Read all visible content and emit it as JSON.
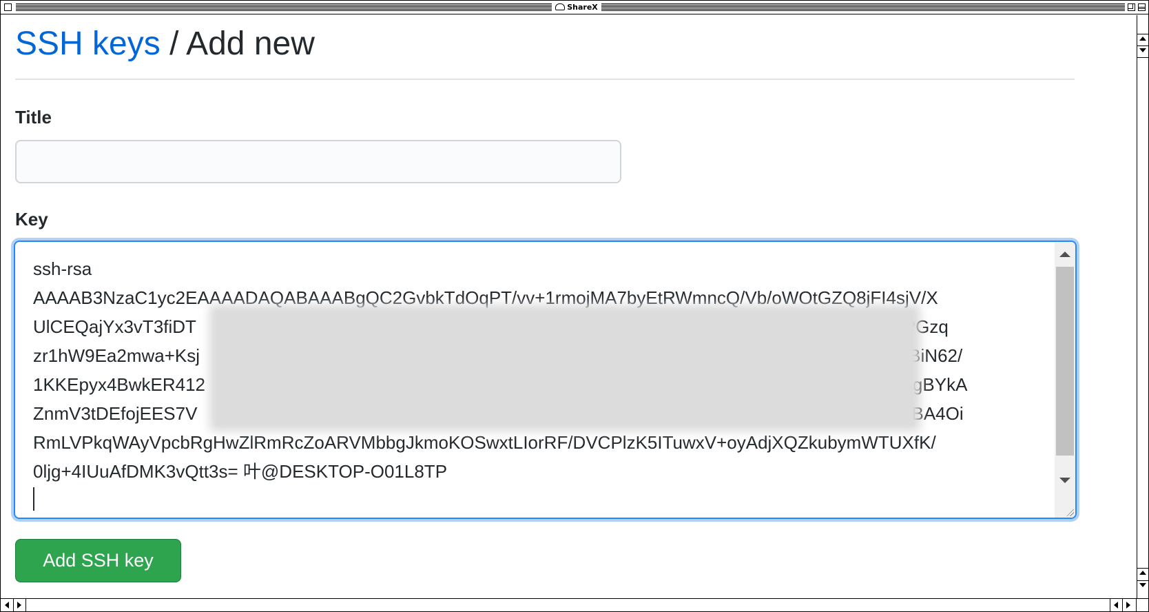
{
  "window": {
    "title": "ShareX"
  },
  "page": {
    "breadcrumb_link": "SSH keys",
    "breadcrumb_separator": " / ",
    "breadcrumb_current": "Add new"
  },
  "form": {
    "title_label": "Title",
    "title_value": "",
    "key_label": "Key",
    "key_lines": [
      "ssh-rsa",
      "AAAAB3NzaC1yc2EAAAADAQABAAABgQC2GvbkTdOqPT/vv+1rmojMA7byEtRWmncQ/Vb/oWOtGZQ8jFI4sjV/X",
      "UlCEQajYx3vT3fiDT",
      "zr1hW9Ea2mwa+Ksj",
      "1KKEpyx4BwkER412",
      "ZnmV3tDEfojEES7V",
      "RmLVPkqWAyVpcbRgHwZlRmRcZoARVMbbgJkmoKOSwxtLIorRF/DVCPlzK5ITuwxV+oyAdjXQZkubymWTUXfK/",
      "0ljg+4IUuAfDMK3vQtt3s= 叶@DESKTOP-O01L8TP"
    ],
    "key_line_endings": [
      "",
      "",
      "3jjnJzYPGzq",
      "L9oY1BiN62/",
      "oStDXlgBYkA",
      "AOB/PBA4Oi",
      "",
      ""
    ],
    "submit_label": "Add SSH key"
  },
  "colors": {
    "link": "#0366d6",
    "button": "#2ea44f",
    "focus_border": "#2188ff"
  }
}
